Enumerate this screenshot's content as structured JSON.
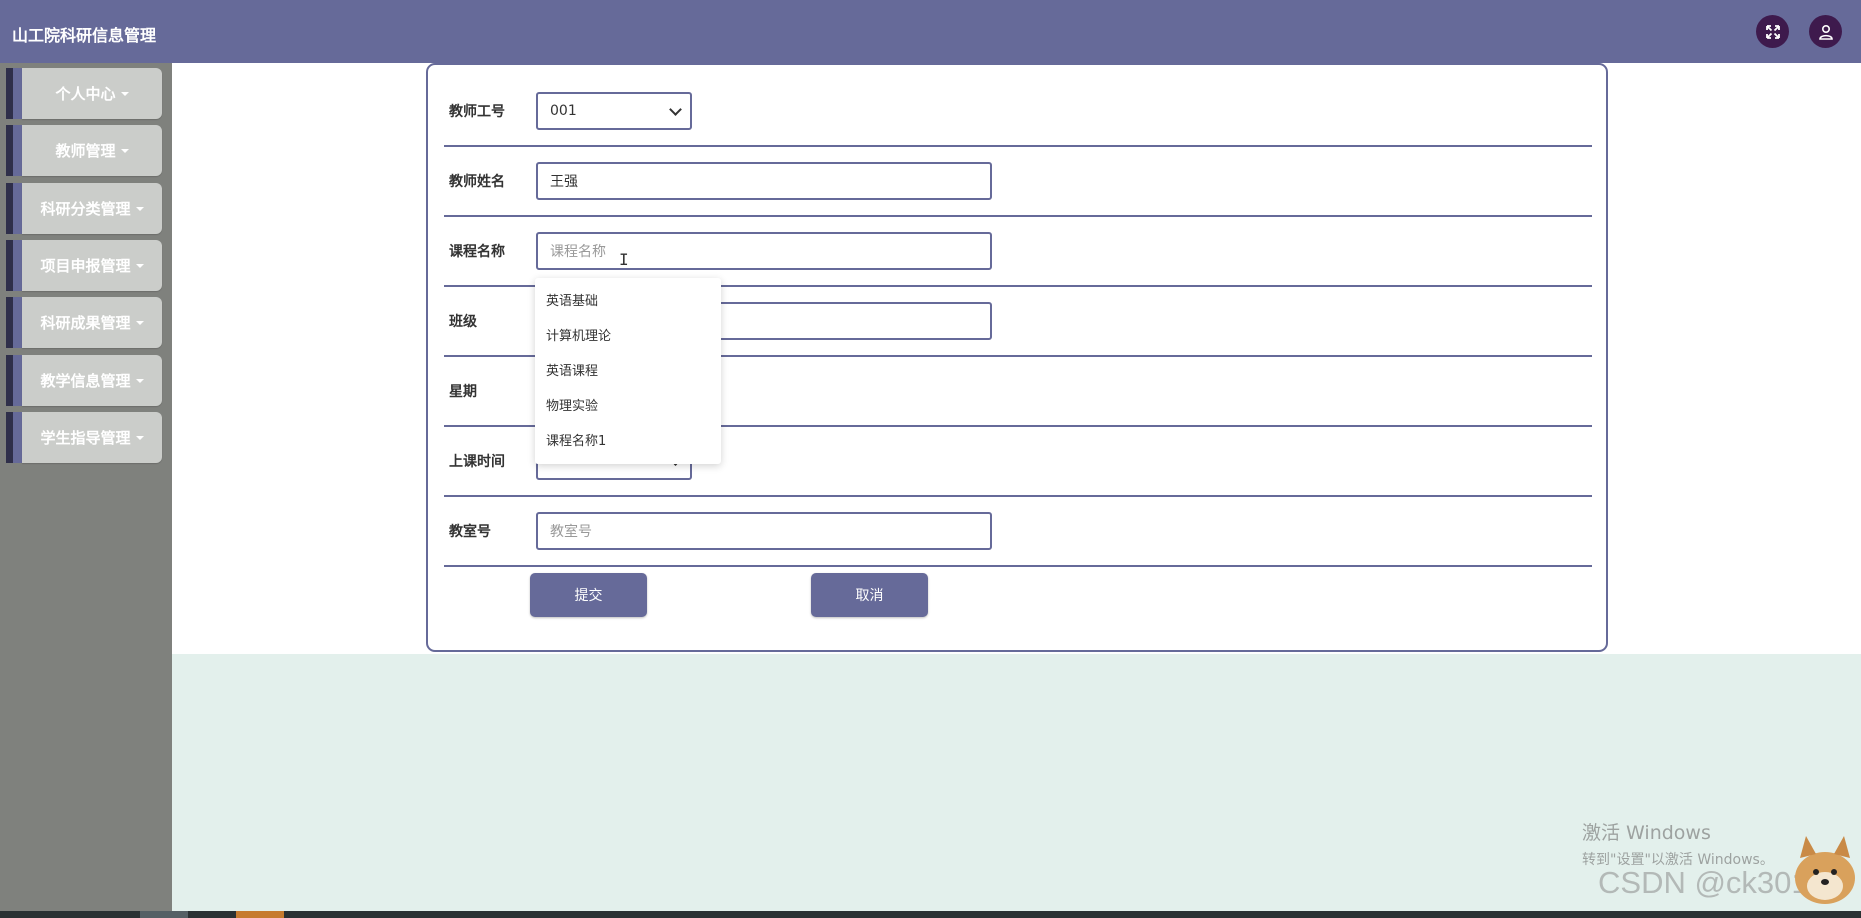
{
  "header": {
    "title": "山工院科研信息管理",
    "icons": [
      "fullscreen-icon",
      "user-icon"
    ]
  },
  "sidebar": {
    "items": [
      {
        "label": "个人中心"
      },
      {
        "label": "教师管理"
      },
      {
        "label": "科研分类管理"
      },
      {
        "label": "项目申报管理"
      },
      {
        "label": "科研成果管理"
      },
      {
        "label": "教学信息管理"
      },
      {
        "label": "学生指导管理"
      }
    ]
  },
  "form": {
    "teacher_id": {
      "label": "教师工号",
      "value": "001"
    },
    "teacher_name": {
      "label": "教师姓名",
      "value": "王强"
    },
    "course_name": {
      "label": "课程名称",
      "placeholder": "课程名称"
    },
    "class": {
      "label": "班级"
    },
    "weekday": {
      "label": "星期"
    },
    "class_time": {
      "label": "上课时间"
    },
    "room": {
      "label": "教室号",
      "placeholder": "教室号"
    },
    "submit_label": "提交",
    "cancel_label": "取消"
  },
  "dropdown": {
    "options": [
      "英语基础",
      "计算机理论",
      "英语课程",
      "物理实验",
      "课程名称1"
    ]
  },
  "overlay": {
    "activate_title": "激活 Windows",
    "activate_sub": "转到\"设置\"以激活 Windows。",
    "csdn": "CSDN @ck3018"
  },
  "colors": {
    "accent": "#666a99",
    "header_icon_bg": "#3e1a4d",
    "sidebar_bg": "#7f817d",
    "sidebar_button": "#cbcdca",
    "page_bg": "#e3f0ec"
  }
}
